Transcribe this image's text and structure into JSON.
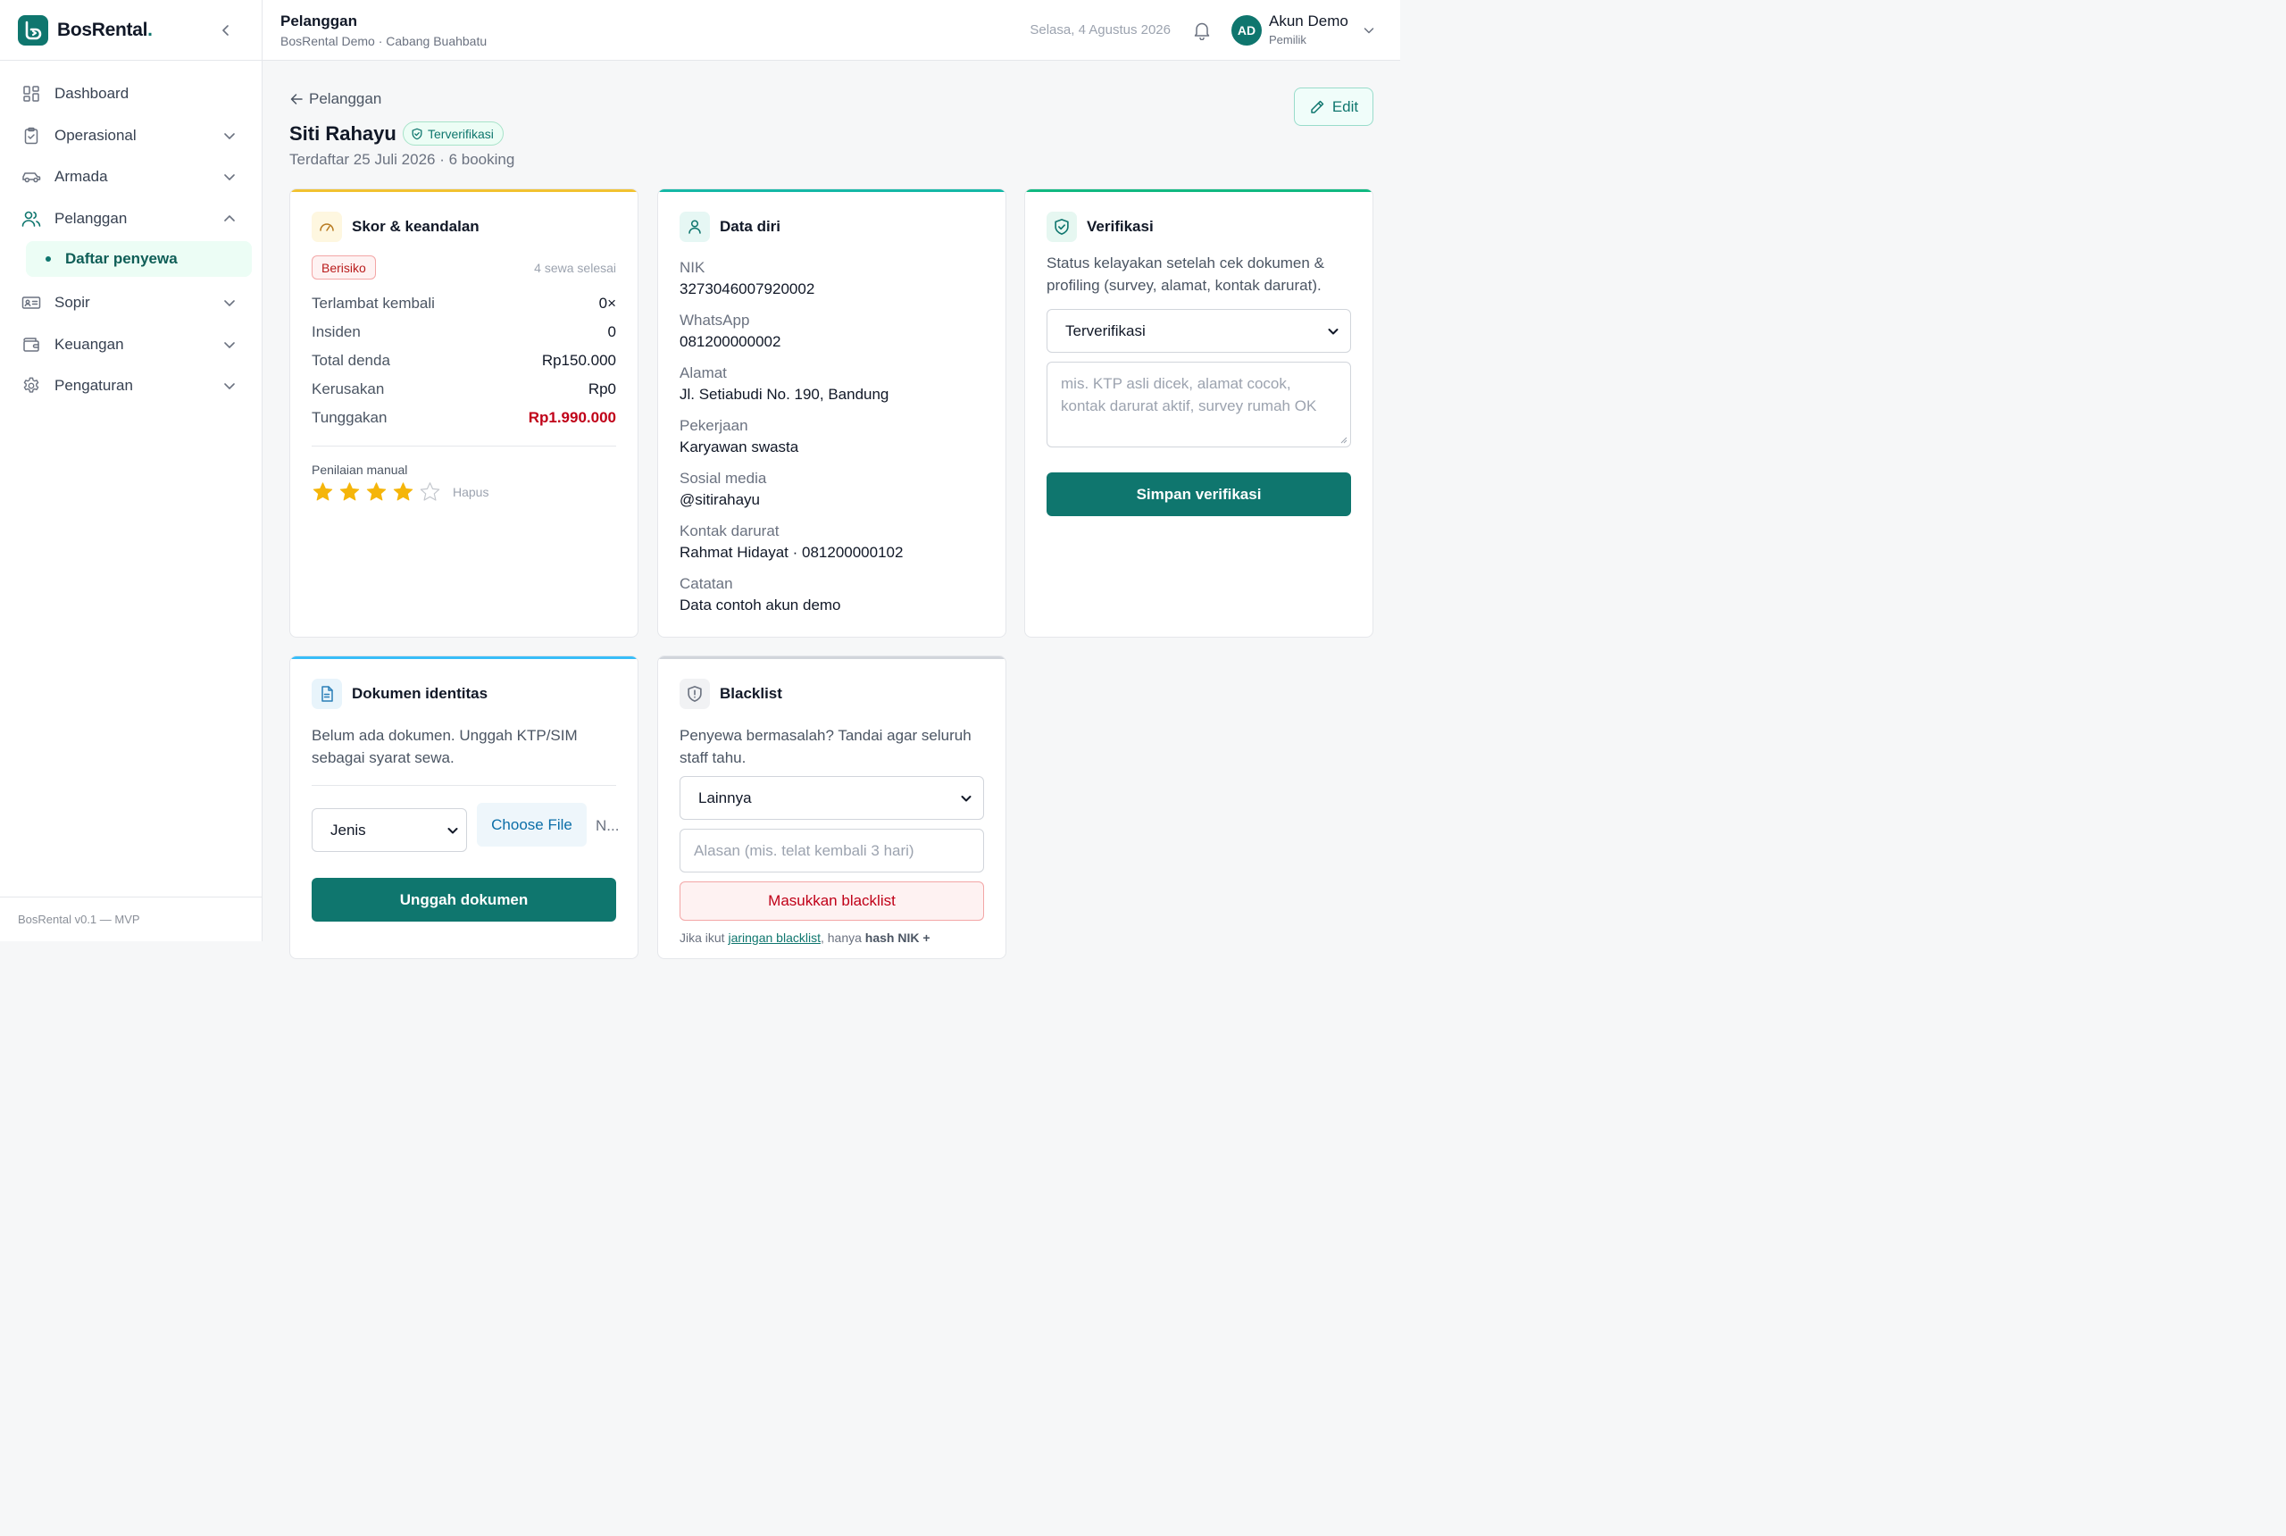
{
  "brand": {
    "name": "BosRental",
    "dot": "."
  },
  "sidebar": {
    "items": [
      {
        "label": "Dashboard"
      },
      {
        "label": "Operasional"
      },
      {
        "label": "Armada"
      },
      {
        "label": "Pelanggan"
      },
      {
        "label": "Sopir"
      },
      {
        "label": "Keuangan"
      },
      {
        "label": "Pengaturan"
      }
    ],
    "sub_active": "Daftar penyewa",
    "footer": "BosRental v0.1 — MVP"
  },
  "header": {
    "title": "Pelanggan",
    "subtitle": "BosRental Demo · Cabang Buahbatu",
    "date": "Selasa, 4 Agustus 2026",
    "user_initials": "AD",
    "user_name": "Akun Demo",
    "user_role": "Pemilik"
  },
  "page": {
    "back_label": "Pelanggan",
    "customer_name": "Siti Rahayu",
    "status_badge": "Terverifikasi",
    "meta": "Terdaftar 25 Juli 2026 · 6 booking",
    "edit_label": "Edit"
  },
  "score_card": {
    "title": "Skor & keandalan",
    "risk_badge": "Berisiko",
    "completed": "4 sewa selesai",
    "stats": [
      {
        "label": "Terlambat kembali",
        "value": "0×"
      },
      {
        "label": "Insiden",
        "value": "0"
      },
      {
        "label": "Total denda",
        "value": "Rp150.000"
      },
      {
        "label": "Kerusakan",
        "value": "Rp0"
      },
      {
        "label": "Tunggakan",
        "value": "Rp1.990.000"
      }
    ],
    "manual_label": "Penilaian manual",
    "rating": 4,
    "rating_max": 5,
    "clear_label": "Hapus"
  },
  "personal_card": {
    "title": "Data diri",
    "fields": [
      {
        "label": "NIK",
        "value": "3273046007920002"
      },
      {
        "label": "WhatsApp",
        "value": "081200000002"
      },
      {
        "label": "Alamat",
        "value": "Jl. Setiabudi No. 190, Bandung"
      },
      {
        "label": "Pekerjaan",
        "value": "Karyawan swasta"
      },
      {
        "label": "Sosial media",
        "value": "@sitirahayu"
      },
      {
        "label": "Kontak darurat",
        "value": "Rahmat Hidayat · 081200000102"
      },
      {
        "label": "Catatan",
        "value": "Data contoh akun demo"
      }
    ]
  },
  "verification_card": {
    "title": "Verifikasi",
    "description": "Status kelayakan setelah cek dokumen & profiling (survey, alamat, kontak darurat).",
    "status_value": "Terverifikasi",
    "notes_placeholder": "mis. KTP asli dicek, alamat cocok, kontak darurat aktif, survey rumah OK",
    "save_label": "Simpan verifikasi"
  },
  "documents_card": {
    "title": "Dokumen identitas",
    "description": "Belum ada dokumen. Unggah KTP/SIM sebagai syarat sewa.",
    "type_select": "Jenis",
    "choose_file": "Choose File",
    "no_file": "N...",
    "upload_label": "Unggah dokumen"
  },
  "blacklist_card": {
    "title": "Blacklist",
    "description": "Penyewa bermasalah? Tandai agar seluruh staff tahu.",
    "reason_select": "Lainnya",
    "reason_placeholder": "Alasan (mis. telat kembali 3 hari)",
    "submit_label": "Masukkan blacklist",
    "note_prefix": "Jika ikut",
    "note_link": "jaringan blacklist",
    "note_mid": ", hanya",
    "note_bold": "hash NIK +"
  },
  "colors": {
    "primary": "#0f766e",
    "score_accent": "#f2c230",
    "personal_accent": "#14b8a6",
    "verify_accent": "#10b981",
    "docs_accent": "#38bdf8",
    "blacklist_accent": "#d1d5db",
    "danger": "#c00018"
  }
}
